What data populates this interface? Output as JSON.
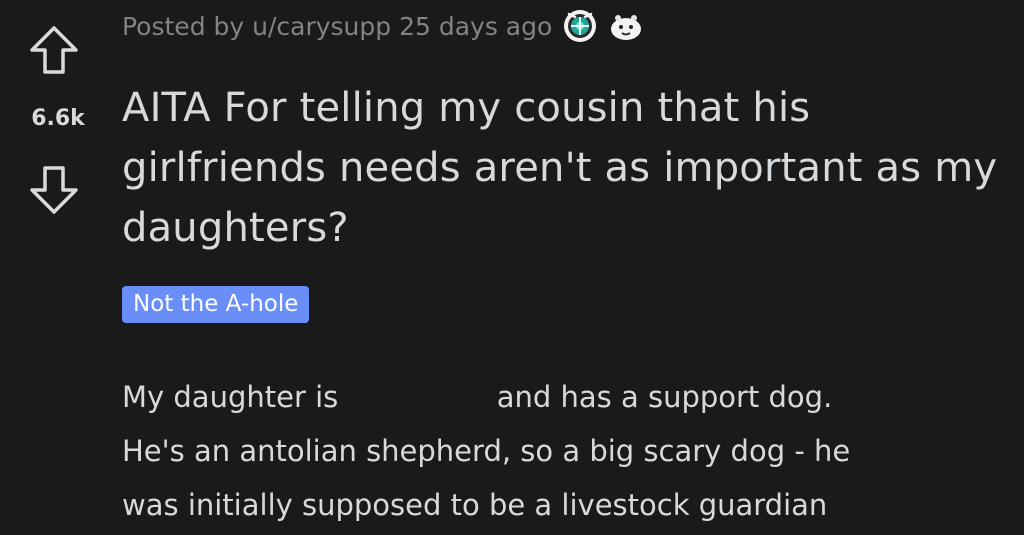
{
  "post": {
    "meta": {
      "posted_by": "Posted by u/carysupp 25 days ago",
      "awards": [
        "award-badge-icon",
        "award-seal-icon"
      ]
    },
    "votes": {
      "score": "6.6k",
      "upvote_icon": "arrow-up-outline-icon",
      "downvote_icon": "arrow-down-outline-icon"
    },
    "title": "AITA For telling my cousin that his girlfriends needs aren't as important as my daughters?",
    "flair": "Not the A-hole",
    "body": {
      "line1_start": "My daughter is",
      "line1_end": "and has a support dog.",
      "line2": "He's an antolian shepherd, so a big scary dog - he",
      "line3": "was initially supposed to be a livestock guardian"
    }
  },
  "colors": {
    "background": "#1a1a1b",
    "text": "#d7dadc",
    "meta_text": "#818384",
    "flair_bg": "#6a8ef7",
    "flair_text": "#ffffff"
  }
}
